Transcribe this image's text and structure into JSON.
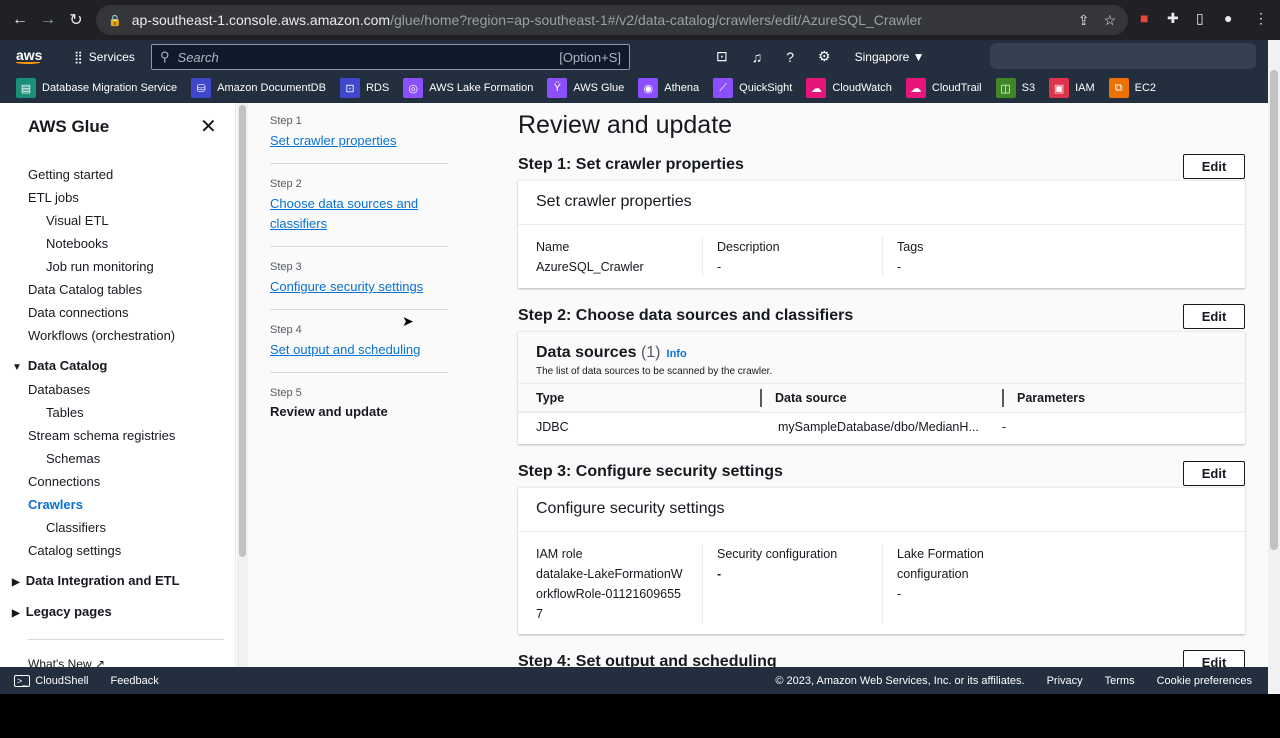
{
  "browser": {
    "url_host": "ap-southeast-1.console.aws.amazon.com",
    "url_path": "/glue/home?region=ap-southeast-1#/v2/data-catalog/crawlers/edit/AzureSQL_Crawler"
  },
  "aws_nav": {
    "logo": "aws",
    "services": "Services",
    "search_placeholder": "Search",
    "search_shortcut": "[Option+S]",
    "region": "Singapore ▼"
  },
  "favorites": [
    {
      "label": "Database Migration Service",
      "color": "#1a8f7a",
      "glyph": "▤"
    },
    {
      "label": "Amazon DocumentDB",
      "color": "#3f48cc",
      "glyph": "⛁"
    },
    {
      "label": "RDS",
      "color": "#3f48cc",
      "glyph": "⊡"
    },
    {
      "label": "AWS Lake Formation",
      "color": "#8c4fff",
      "glyph": "◎"
    },
    {
      "label": "AWS Glue",
      "color": "#8c4fff",
      "glyph": "Ÿ"
    },
    {
      "label": "Athena",
      "color": "#8c4fff",
      "glyph": "◉"
    },
    {
      "label": "QuickSight",
      "color": "#8c4fff",
      "glyph": "⟋"
    },
    {
      "label": "CloudWatch",
      "color": "#e7157b",
      "glyph": "☁"
    },
    {
      "label": "CloudTrail",
      "color": "#e7157b",
      "glyph": "☁"
    },
    {
      "label": "S3",
      "color": "#3f8624",
      "glyph": "◫"
    },
    {
      "label": "IAM",
      "color": "#dd344c",
      "glyph": "▣"
    },
    {
      "label": "EC2",
      "color": "#ed7100",
      "glyph": "⧉"
    }
  ],
  "sidebar": {
    "title": "AWS Glue",
    "items": [
      {
        "label": "Getting started",
        "kind": ""
      },
      {
        "label": "ETL jobs",
        "kind": ""
      },
      {
        "label": "Visual ETL",
        "kind": "sub"
      },
      {
        "label": "Notebooks",
        "kind": "sub"
      },
      {
        "label": "Job run monitoring",
        "kind": "sub"
      },
      {
        "label": "Data Catalog tables",
        "kind": ""
      },
      {
        "label": "Data connections",
        "kind": ""
      },
      {
        "label": "Workflows (orchestration)",
        "kind": ""
      }
    ],
    "sections": [
      {
        "label": "Data Catalog",
        "tri": "▼"
      },
      {
        "label": "Data Integration and ETL",
        "tri": "▶"
      },
      {
        "label": "Legacy pages",
        "tri": "▶"
      }
    ],
    "catalog_items": [
      {
        "label": "Databases",
        "kind": ""
      },
      {
        "label": "Tables",
        "kind": "sub"
      },
      {
        "label": "Stream schema registries",
        "kind": ""
      },
      {
        "label": "Schemas",
        "kind": "sub"
      },
      {
        "label": "Connections",
        "kind": ""
      },
      {
        "label": "Crawlers",
        "kind": "active"
      },
      {
        "label": "Classifiers",
        "kind": "sub"
      },
      {
        "label": "Catalog settings",
        "kind": ""
      }
    ],
    "whats_new": "What's New ↗"
  },
  "steps": [
    {
      "n": "Step 1",
      "label": "Set crawler properties"
    },
    {
      "n": "Step 2",
      "label": "Choose data sources and classifiers"
    },
    {
      "n": "Step 3",
      "label": "Configure security settings"
    },
    {
      "n": "Step 4",
      "label": "Set output and scheduling"
    },
    {
      "n": "Step 5",
      "label": "Review and update"
    }
  ],
  "main": {
    "title": "Review and update",
    "edit": "Edit",
    "s1": {
      "heading": "Step 1: Set crawler properties",
      "card_title": "Set crawler properties",
      "name_label": "Name",
      "name": "AzureSQL_Crawler",
      "desc_label": "Description",
      "desc": "-",
      "tags_label": "Tags",
      "tags": "-"
    },
    "s2": {
      "heading": "Step 2: Choose data sources and classifiers",
      "title": "Data sources",
      "count": "(1)",
      "info": "Info",
      "desc": "The list of data sources to be scanned by the crawler.",
      "columns": [
        "Type",
        "Data source",
        "Parameters"
      ],
      "row": [
        "JDBC",
        "mySampleDatabase/dbo/MedianH...",
        "-"
      ]
    },
    "s3": {
      "heading": "Step 3: Configure security settings",
      "card_title": "Configure security settings",
      "iam_label": "IAM role",
      "iam": "datalake-LakeFormationWorkflowRole-011216096557",
      "sec_label": "Security configuration",
      "sec": "-",
      "lf_label": "Lake Formation configuration",
      "lf": "-"
    },
    "s4": {
      "heading": "Step 4: Set output and scheduling"
    }
  },
  "footer": {
    "cloudshell": "CloudShell",
    "feedback": "Feedback",
    "copyright": "© 2023, Amazon Web Services, Inc. or its affiliates.",
    "privacy": "Privacy",
    "terms": "Terms",
    "cookies": "Cookie preferences"
  }
}
